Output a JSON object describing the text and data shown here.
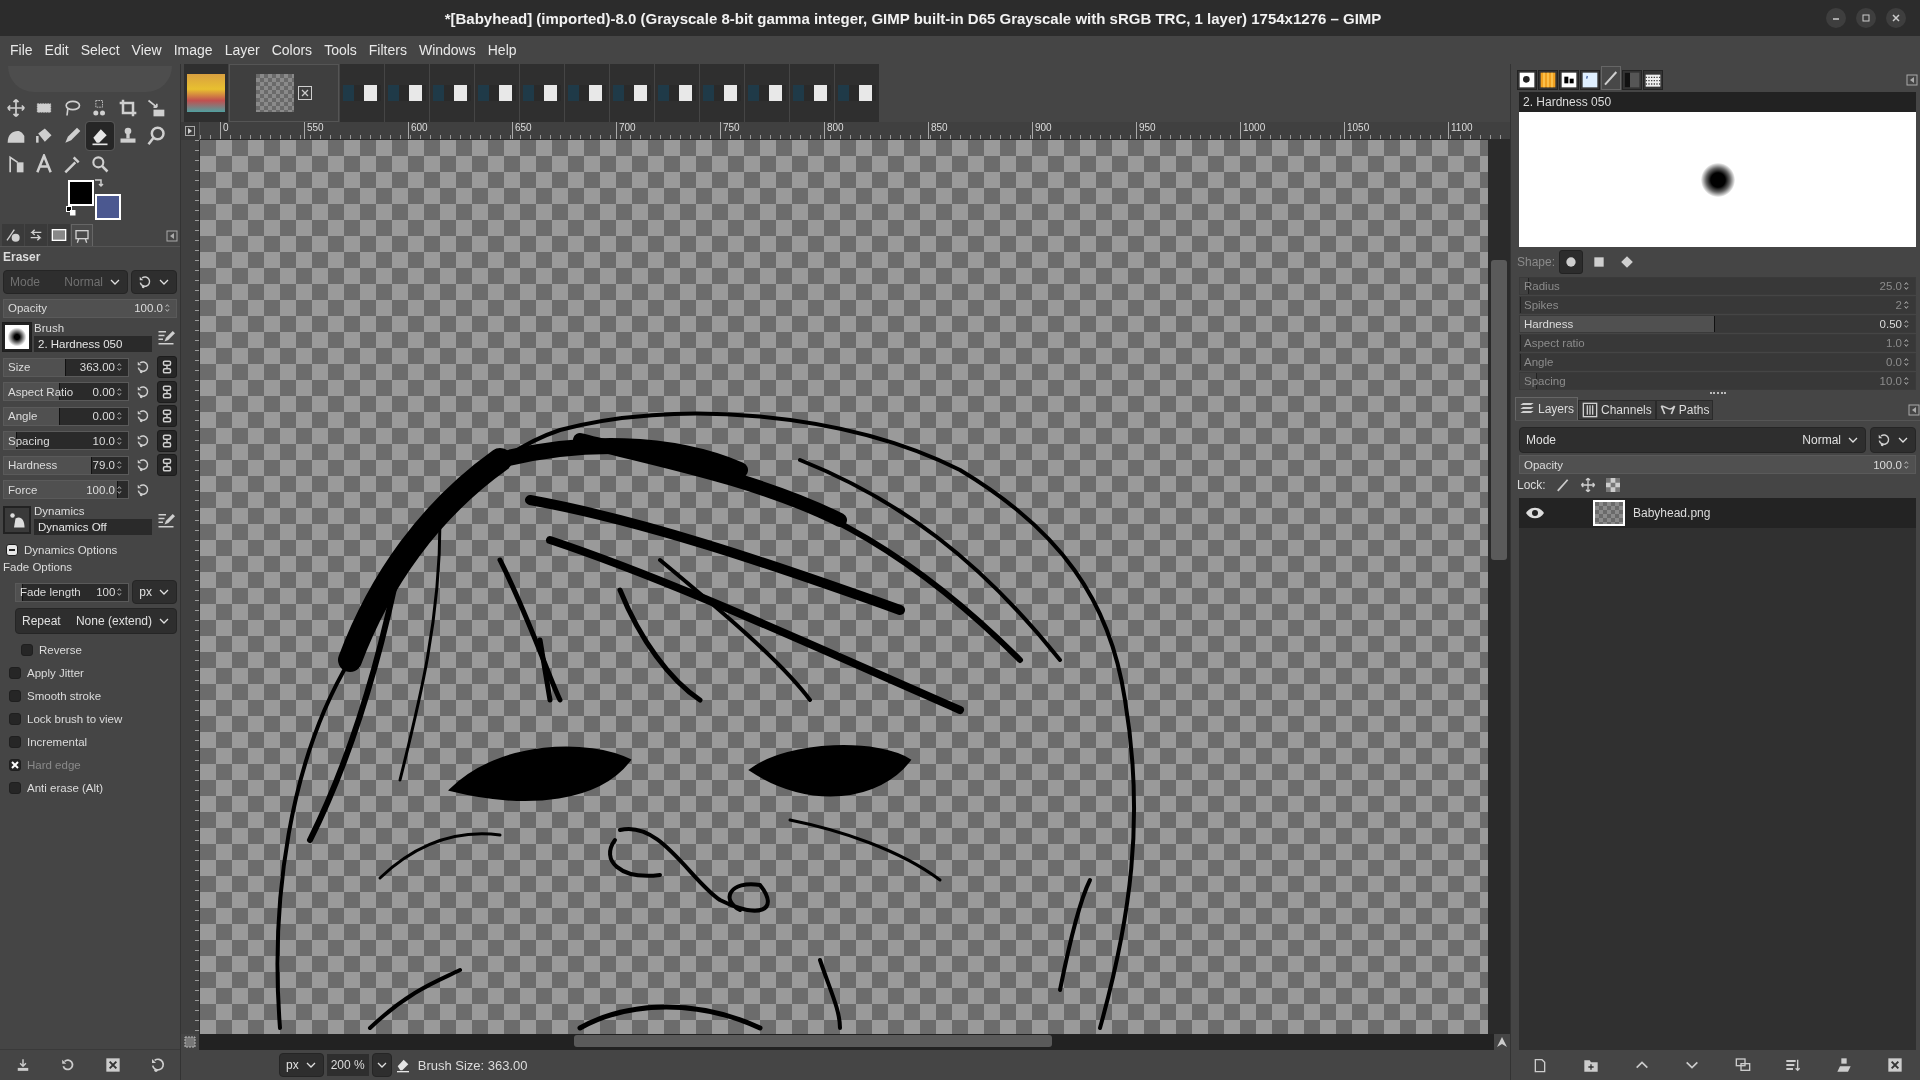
{
  "title": "*[Babyhead] (imported)-8.0 (Grayscale 8-bit gamma integer, GIMP built-in D65 Grayscale with sRGB TRC, 1 layer) 1754x1276 – GIMP",
  "menu": [
    "File",
    "Edit",
    "Select",
    "View",
    "Image",
    "Layer",
    "Colors",
    "Tools",
    "Filters",
    "Windows",
    "Help"
  ],
  "tools": [
    {
      "kind": "move",
      "selected": false
    },
    {
      "kind": "rect-select",
      "selected": false
    },
    {
      "kind": "lasso",
      "selected": false
    },
    {
      "kind": "fuzzy-select",
      "selected": false
    },
    {
      "kind": "crop",
      "selected": false
    },
    {
      "kind": "transform",
      "selected": false
    },
    {
      "kind": "warp",
      "selected": false
    },
    {
      "kind": "bucket",
      "selected": false
    },
    {
      "kind": "pencil",
      "selected": false
    },
    {
      "kind": "eraser",
      "selected": true
    },
    {
      "kind": "stamp",
      "selected": false
    },
    {
      "kind": "smudge",
      "selected": false
    },
    {
      "kind": "path",
      "selected": false
    },
    {
      "kind": "text",
      "selected": false
    },
    {
      "kind": "eyedropper",
      "selected": false
    },
    {
      "kind": "zoom",
      "selected": false
    }
  ],
  "colors": [
    {
      "kind": "foreground",
      "color": "#000000"
    },
    {
      "kind": "background",
      "color": "#4b5890"
    }
  ],
  "left_dock_tabs": [
    {
      "kind": "info",
      "selected": false
    },
    {
      "kind": "undo",
      "selected": false
    },
    {
      "kind": "images",
      "selected": false
    },
    {
      "kind": "easel",
      "selected": true
    }
  ],
  "tool_options": {
    "title": "Eraser",
    "mode": {
      "label": "Mode",
      "value": "Normal",
      "disabled": true
    },
    "opacity": {
      "label": "Opacity",
      "reading": "100.0",
      "level": 1
    },
    "brush": {
      "label": "Brush",
      "value": "2. Hardness 050"
    },
    "sliders": [
      {
        "label": "Size",
        "reading": "363.00",
        "level": 0.49,
        "kind": "linked"
      },
      {
        "label": "Aspect Ratio",
        "reading": "0.00",
        "level": 0.44,
        "kind": "linked"
      },
      {
        "label": "Angle",
        "reading": "0.00",
        "level": 0.44,
        "kind": "linked"
      },
      {
        "label": "Spacing",
        "reading": "10.0",
        "level": 0.1,
        "kind": "linked"
      },
      {
        "label": "Hardness",
        "reading": "79.0",
        "level": 0.7,
        "kind": "linked"
      },
      {
        "label": "Force",
        "reading": "100.0",
        "level": 0.91,
        "kind": "plain"
      }
    ],
    "dynamics": {
      "label": "Dynamics",
      "value": "Dynamics Off"
    },
    "dynamics_options": {
      "label": "Dynamics Options",
      "expanded": true
    },
    "fade": {
      "label": "Fade Options",
      "length": {
        "label": "Fade length",
        "reading": "100",
        "level": 0.05
      },
      "unit": "px",
      "repeat": {
        "label": "Repeat",
        "value": "None (extend)"
      },
      "reverse": {
        "label": "Reverse",
        "checked": false
      }
    },
    "checkboxes": [
      {
        "label": "Apply Jitter",
        "checked": false,
        "disabled": false
      },
      {
        "label": "Smooth stroke",
        "checked": false,
        "disabled": false
      },
      {
        "label": "Lock brush to view",
        "checked": false,
        "disabled": false
      },
      {
        "label": "Incremental",
        "checked": false,
        "disabled": false
      },
      {
        "label": "Hard edge",
        "checked": true,
        "disabled": true
      },
      {
        "label": "Anti erase  (Alt)",
        "checked": false,
        "disabled": false
      }
    ]
  },
  "image_tabs": [
    {
      "kind": "photo",
      "selected": false
    },
    {
      "kind": "transparent",
      "selected": true
    },
    {
      "kind": "screenshot",
      "selected": false
    },
    {
      "kind": "screenshot",
      "selected": false
    },
    {
      "kind": "screenshot",
      "selected": false
    },
    {
      "kind": "screenshot",
      "selected": false
    },
    {
      "kind": "screenshot",
      "selected": false
    },
    {
      "kind": "screenshot",
      "selected": false
    },
    {
      "kind": "screenshot",
      "selected": false
    },
    {
      "kind": "screenshot",
      "selected": false
    },
    {
      "kind": "screenshot",
      "selected": false
    },
    {
      "kind": "screenshot",
      "selected": false
    },
    {
      "kind": "screenshot",
      "selected": false
    },
    {
      "kind": "screenshot",
      "selected": false
    }
  ],
  "ruler": {
    "labels": [
      "0",
      "550",
      "600",
      "650",
      "700",
      "750",
      "800",
      "850",
      "900",
      "950",
      "1000",
      "1050",
      "1100"
    ]
  },
  "status": {
    "unit": "px",
    "zoom": "200 %",
    "message": "Brush Size: 363.00"
  },
  "brush_editor": {
    "tabs": [
      {
        "kind": "brushes",
        "selected": false
      },
      {
        "kind": "gradients",
        "selected": false
      },
      {
        "kind": "fonts",
        "selected": false
      },
      {
        "kind": "document",
        "selected": false
      },
      {
        "kind": "brush-editor",
        "selected": true
      },
      {
        "kind": "gradient-editor",
        "selected": false
      },
      {
        "kind": "patterns",
        "selected": false
      }
    ],
    "name": "2. Hardness 050",
    "shape_label": "Shape:",
    "shapes": [
      {
        "kind": "circle",
        "selected": true
      },
      {
        "kind": "square",
        "selected": false
      },
      {
        "kind": "diamond",
        "selected": false
      }
    ],
    "sliders": [
      {
        "label": "Radius",
        "reading": "25.0",
        "level": 0.02,
        "disabled": true
      },
      {
        "label": "Spikes",
        "reading": "2",
        "level": 0,
        "disabled": true
      },
      {
        "label": "Hardness",
        "reading": "0.50",
        "level": 0.49,
        "disabled": false
      },
      {
        "label": "Aspect ratio",
        "reading": "1.0",
        "level": 0,
        "disabled": true
      },
      {
        "label": "Angle",
        "reading": "0.0",
        "level": 0,
        "disabled": true
      },
      {
        "label": "Spacing",
        "reading": "10.0",
        "level": 0.04,
        "disabled": true
      }
    ]
  },
  "layers_dock": {
    "tabs": [
      {
        "label": "Layers",
        "kind": "layers",
        "selected": true
      },
      {
        "label": "Channels",
        "kind": "channels",
        "selected": false
      },
      {
        "label": "Paths",
        "kind": "paths",
        "selected": false
      }
    ],
    "mode": {
      "label": "Mode",
      "value": "Normal"
    },
    "opacity": {
      "label": "Opacity",
      "reading": "100.0",
      "level": 1
    },
    "lock_label": "Lock:",
    "layers": [
      {
        "name": "Babyhead.png",
        "visible": true,
        "selected": true
      }
    ]
  }
}
